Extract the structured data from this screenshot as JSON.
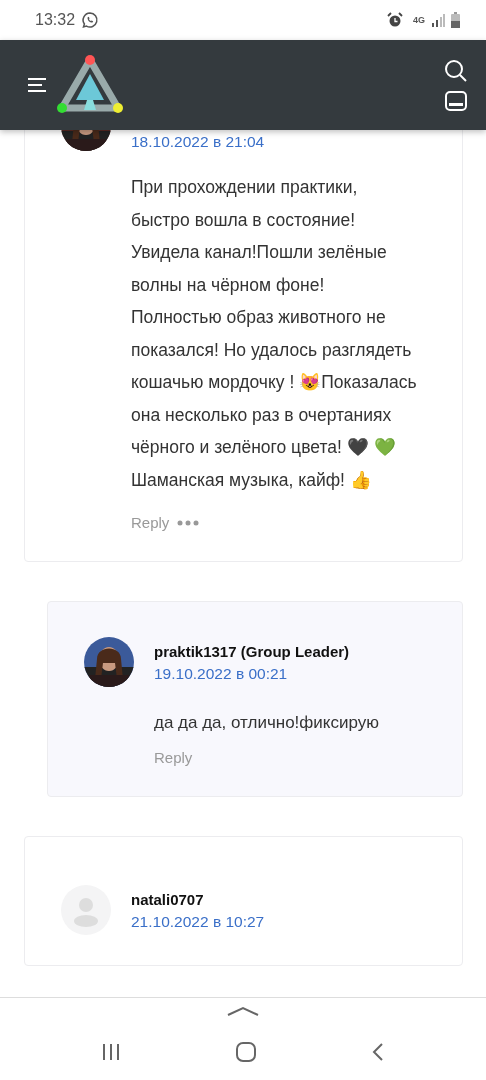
{
  "status_bar": {
    "time": "13:32",
    "network": "4G"
  },
  "comments": [
    {
      "kind": "partial",
      "photo": true,
      "date": "18.10.2022 в 21:04",
      "text": "При прохождении практики, быстро вошла в состояние! Увидела канал!Пошли зелёные волны на чёрном фоне! Полностью образ животного не показался! Но удалось разглядеть кошачью мордочку ! 😻Показалась она несколько раз в очертаниях чёрного и зелёного цвета! 🖤 💚 Шаманская музыка, кайф! 👍",
      "reply": "Reply",
      "more": true,
      "nested": false
    },
    {
      "kind": "full",
      "photo": true,
      "author": "praktik1317 (Group Leader)",
      "date": "19.10.2022 в 00:21",
      "text": "да да да, отлично!фиксирую",
      "reply": "Reply",
      "more": false,
      "nested": true
    },
    {
      "kind": "full",
      "photo": false,
      "author": "natali0707",
      "date": "21.10.2022 в 10:27",
      "nested": false
    }
  ]
}
